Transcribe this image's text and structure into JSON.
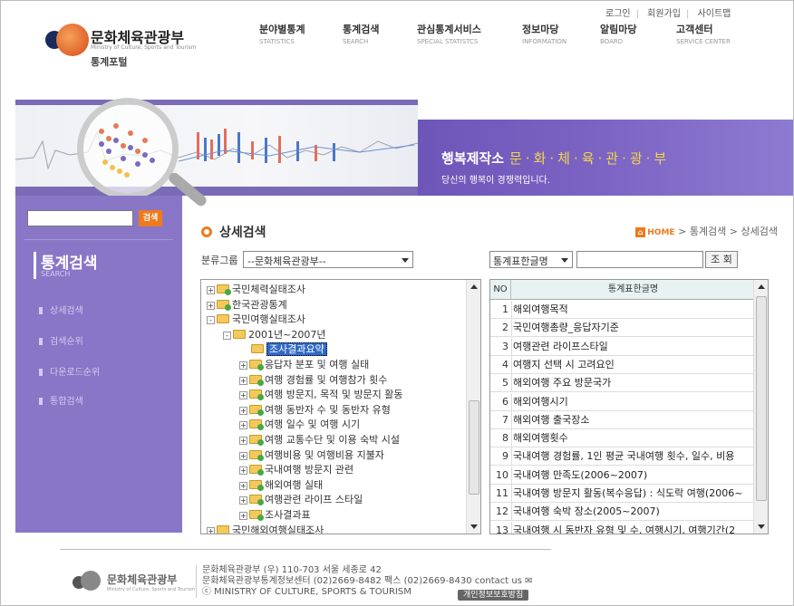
{
  "util_links": [
    "로그인",
    "회원가입",
    "사이트맵"
  ],
  "logo": {
    "name": "문화체육관광부",
    "eng": "Ministry of Culture, Sports and Tourism",
    "portal": "통계포털"
  },
  "gnb": [
    {
      "k": "분야별통계",
      "e": "STATISTICS"
    },
    {
      "k": "통계검색",
      "e": "SEARCH"
    },
    {
      "k": "관심통계서비스",
      "e": "SPECIAL STATISTCS"
    },
    {
      "k": "정보마당",
      "e": "INFORMATION"
    },
    {
      "k": "알림마당",
      "e": "BOARD"
    },
    {
      "k": "고객센터",
      "e": "SERVICE CENTER"
    }
  ],
  "banner": {
    "slogan_a": "행복제작소",
    "slogan_b": "문·화·체·육·관·광·부",
    "slogan_sub": "당신의 행복이 경쟁력입니다."
  },
  "left": {
    "search_btn": "검색",
    "title": "통계검색",
    "title_en": "SEARCH",
    "menu": [
      "상세검색",
      "검색순위",
      "다운로드순위",
      "통합검색"
    ]
  },
  "page": {
    "title": "상세검색",
    "breadcrumb": {
      "home": "HOME",
      "items": [
        "통계검색",
        "상세검색"
      ],
      "sep": ">"
    }
  },
  "filters": {
    "group_label": "분류그룹",
    "group_value": "--문화체육관광부--",
    "type_value": "통계표한글명",
    "search_btn": "조 회"
  },
  "tree": [
    {
      "label": "국민체력실태조사",
      "level": 0,
      "pm": "+",
      "ok": true
    },
    {
      "label": "한국관광통계",
      "level": 0,
      "pm": "+",
      "ok": true
    },
    {
      "label": "국민여행실태조사",
      "level": 0,
      "pm": "-",
      "ok": false
    },
    {
      "label": "2001년~2007년",
      "level": 1,
      "pm": "-",
      "ok": false
    },
    {
      "label": "조사결과요약",
      "level": 2,
      "pm": "",
      "ok": false,
      "selected": true
    },
    {
      "label": "응답자 분포 및 여행 실태",
      "level": 2,
      "pm": "+",
      "ok": true
    },
    {
      "label": "여행 경험률 및 여행참가 횟수",
      "level": 2,
      "pm": "+",
      "ok": true
    },
    {
      "label": "여행 방문지, 목적 및 방문지 활동",
      "level": 2,
      "pm": "+",
      "ok": true
    },
    {
      "label": "여행 동반자 수 및 동반자 유형",
      "level": 2,
      "pm": "+",
      "ok": true
    },
    {
      "label": "여행 일수 및 여행 시기",
      "level": 2,
      "pm": "+",
      "ok": true
    },
    {
      "label": "여행 교통수단 및 이용 숙박 시설",
      "level": 2,
      "pm": "+",
      "ok": true
    },
    {
      "label": "여행비용 및 여행비용 지불자",
      "level": 2,
      "pm": "+",
      "ok": true
    },
    {
      "label": "국내여행 방문지 관련",
      "level": 2,
      "pm": "+",
      "ok": true
    },
    {
      "label": "해외여행 실태",
      "level": 2,
      "pm": "+",
      "ok": true
    },
    {
      "label": "여행관련 라이프 스타일",
      "level": 2,
      "pm": "+",
      "ok": true
    },
    {
      "label": "조사결과표",
      "level": 2,
      "pm": "+",
      "ok": true
    },
    {
      "label": "국민해외여행실태조사",
      "level": 0,
      "pm": "+",
      "ok": false
    }
  ],
  "table": {
    "headers": [
      "NO",
      "통계표한글명"
    ],
    "rows": [
      {
        "no": "1",
        "name": "해외여행목적"
      },
      {
        "no": "2",
        "name": "국민여행총량_응답자기준"
      },
      {
        "no": "3",
        "name": "여행관련 라이프스타일"
      },
      {
        "no": "4",
        "name": "여행지 선택 시 고려요인"
      },
      {
        "no": "5",
        "name": "해외여행 주요 방문국가"
      },
      {
        "no": "6",
        "name": "해외여행시기"
      },
      {
        "no": "7",
        "name": "해외여행 출국장소"
      },
      {
        "no": "8",
        "name": "해외여행횟수"
      },
      {
        "no": "9",
        "name": "국내여행 경험률, 1인 평균 국내여행 횟수, 일수, 비용"
      },
      {
        "no": "10",
        "name": "국내여행 만족도(2006~2007)"
      },
      {
        "no": "11",
        "name": "국내여행 방문지 활동(복수응답) : 식도락 여행(2006~"
      },
      {
        "no": "12",
        "name": "국내여행 숙박 장소(2005~2007)"
      },
      {
        "no": "13",
        "name": "국내여행 시 동반자 유형 및 수, 여행시기, 여행기간(2"
      }
    ]
  },
  "footer": {
    "logo_name": "문화체육관광부",
    "logo_eng": "Ministry of Culture, Sports and Tourism",
    "line1": "문화체육관광부 (우) 110-703 서울 세종로 42",
    "line2": "문화체육관광부통계정보센터 (02)2669-8482 팩스 (02)2669-8430 contact us ✉",
    "line3": "ⓒ MINISTRY OF CULTURE, SPORTS & TOURISM",
    "privacy": "개인정보보호방침"
  },
  "colors": {
    "accent": "#f07a1c",
    "purple": "#8976c7",
    "banner_purple": "#7262bf"
  }
}
